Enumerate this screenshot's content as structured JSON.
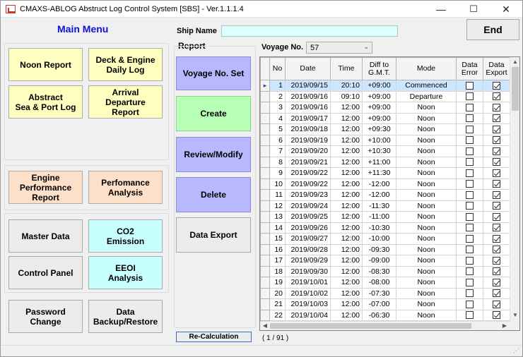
{
  "window": {
    "title": "CMAXS-ABLOG Abstruct Log Control System [SBS] - Ver.1.1.1.4",
    "min_glyph": "—",
    "max_glyph": "☐",
    "close_glyph": "✕"
  },
  "menu": {
    "title": "Main Menu",
    "noon_report": "Noon Report",
    "deck_engine": "Deck & Engine\nDaily Log",
    "abstract": "Abstract\nSea & Port Log",
    "arrival": "Arrival\nDeparture\nReport",
    "engine_perf": "Engine\nPerformance\nReport",
    "perf_analysis": "Perfomance\nAnalysis",
    "master_data": "Master Data",
    "co2": "CO2\nEmission",
    "control_panel": "Control Panel",
    "eeoi": "EEOI\nAnalysis",
    "password": "Password\nChange",
    "backup": "Data\nBackup/Restore"
  },
  "header": {
    "ship_name_label": "Ship Name",
    "ship_name_value": "",
    "end_label": "End",
    "voyage_label": "Voyage No.",
    "voyage_value": "57"
  },
  "report": {
    "label": "Report",
    "voyage_set": "Voyage No. Set",
    "create": "Create",
    "review": "Review/Modify",
    "delete": "Delete",
    "export": "Data Export"
  },
  "table": {
    "columns": [
      "No",
      "Date",
      "Time",
      "Diff to\nG.M.T.",
      "Mode",
      "Data\nError",
      "Data\nExport"
    ],
    "rows": [
      {
        "no": "1",
        "date": "2019/09/15",
        "time": "20:10",
        "diff": "+09:00",
        "mode": "Commenced",
        "err": false,
        "exp": true
      },
      {
        "no": "2",
        "date": "2019/09/16",
        "time": "09:10",
        "diff": "+09:00",
        "mode": "Departure",
        "err": false,
        "exp": true
      },
      {
        "no": "3",
        "date": "2019/09/16",
        "time": "12:00",
        "diff": "+09:00",
        "mode": "Noon",
        "err": false,
        "exp": true
      },
      {
        "no": "4",
        "date": "2019/09/17",
        "time": "12:00",
        "diff": "+09:00",
        "mode": "Noon",
        "err": false,
        "exp": true
      },
      {
        "no": "5",
        "date": "2019/09/18",
        "time": "12:00",
        "diff": "+09:30",
        "mode": "Noon",
        "err": false,
        "exp": true
      },
      {
        "no": "6",
        "date": "2019/09/19",
        "time": "12:00",
        "diff": "+10:00",
        "mode": "Noon",
        "err": false,
        "exp": true
      },
      {
        "no": "7",
        "date": "2019/09/20",
        "time": "12:00",
        "diff": "+10:30",
        "mode": "Noon",
        "err": false,
        "exp": true
      },
      {
        "no": "8",
        "date": "2019/09/21",
        "time": "12:00",
        "diff": "+11:00",
        "mode": "Noon",
        "err": false,
        "exp": true
      },
      {
        "no": "9",
        "date": "2019/09/22",
        "time": "12:00",
        "diff": "+11:30",
        "mode": "Noon",
        "err": false,
        "exp": true
      },
      {
        "no": "10",
        "date": "2019/09/22",
        "time": "12:00",
        "diff": "-12:00",
        "mode": "Noon",
        "err": false,
        "exp": true
      },
      {
        "no": "11",
        "date": "2019/09/23",
        "time": "12:00",
        "diff": "-12:00",
        "mode": "Noon",
        "err": false,
        "exp": true
      },
      {
        "no": "12",
        "date": "2019/09/24",
        "time": "12:00",
        "diff": "-11:30",
        "mode": "Noon",
        "err": false,
        "exp": true
      },
      {
        "no": "13",
        "date": "2019/09/25",
        "time": "12:00",
        "diff": "-11:00",
        "mode": "Noon",
        "err": false,
        "exp": true
      },
      {
        "no": "14",
        "date": "2019/09/26",
        "time": "12:00",
        "diff": "-10:30",
        "mode": "Noon",
        "err": false,
        "exp": true
      },
      {
        "no": "15",
        "date": "2019/09/27",
        "time": "12:00",
        "diff": "-10:00",
        "mode": "Noon",
        "err": false,
        "exp": true
      },
      {
        "no": "16",
        "date": "2019/09/28",
        "time": "12:00",
        "diff": "-09:30",
        "mode": "Noon",
        "err": false,
        "exp": true
      },
      {
        "no": "17",
        "date": "2019/09/29",
        "time": "12:00",
        "diff": "-09:00",
        "mode": "Noon",
        "err": false,
        "exp": true
      },
      {
        "no": "18",
        "date": "2019/09/30",
        "time": "12:00",
        "diff": "-08:30",
        "mode": "Noon",
        "err": false,
        "exp": true
      },
      {
        "no": "19",
        "date": "2019/10/01",
        "time": "12:00",
        "diff": "-08:00",
        "mode": "Noon",
        "err": false,
        "exp": true
      },
      {
        "no": "20",
        "date": "2019/10/02",
        "time": "12:00",
        "diff": "-07:30",
        "mode": "Noon",
        "err": false,
        "exp": true
      },
      {
        "no": "21",
        "date": "2019/10/03",
        "time": "12:00",
        "diff": "-07:00",
        "mode": "Noon",
        "err": false,
        "exp": true
      },
      {
        "no": "22",
        "date": "2019/10/04",
        "time": "12:00",
        "diff": "-06:30",
        "mode": "Noon",
        "err": false,
        "exp": true
      }
    ],
    "selected_row_index": 0,
    "row_pointer_glyph": "▸"
  },
  "footer": {
    "recalc": "Re-Calculation",
    "pager": "( 1 / 91 )"
  },
  "icons": {
    "scroll_up": "▲",
    "scroll_down": "▼",
    "scroll_left": "◀",
    "scroll_right": "▶",
    "dropdown": "⌄",
    "grip": "⋰"
  }
}
